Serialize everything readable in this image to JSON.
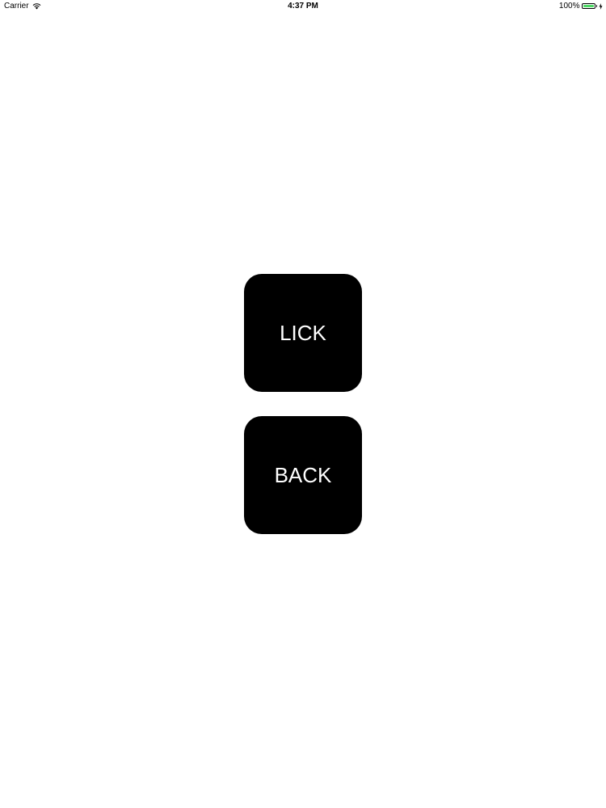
{
  "status_bar": {
    "carrier": "Carrier",
    "time": "4:37 PM",
    "battery_percent": "100%",
    "battery_level": 1.0,
    "battery_color": "#4cd964",
    "icons": [
      "wifi-icon",
      "battery-icon",
      "charging-icon"
    ]
  },
  "buttons": {
    "lick_label": "LICK",
    "back_label": "BACK",
    "background_color": "#000000",
    "text_color": "#ffffff"
  }
}
